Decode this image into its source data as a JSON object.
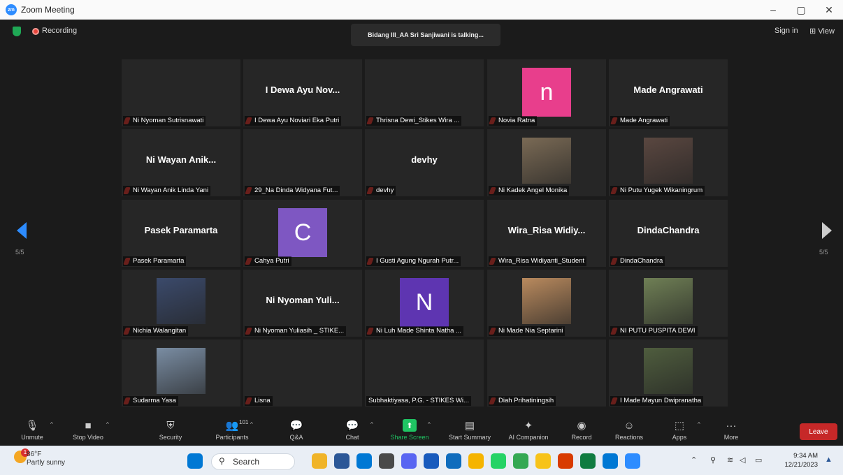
{
  "window": {
    "title": "Zoom Meeting",
    "controls": [
      "–",
      "▢",
      "✕"
    ]
  },
  "topbar": {
    "recording": "Recording",
    "talking": "Bidang III_AA Sri Sanjiwani is talking...",
    "sign_in": "Sign in",
    "view": "View"
  },
  "pagination": {
    "left": "5/5",
    "right": "5/5"
  },
  "participants": [
    {
      "name": "Ni Nyoman Sutrisnawati",
      "big": "",
      "avatar": "",
      "photo": false,
      "muted": true
    },
    {
      "name": "I Dewa Ayu Noviari Eka Putri",
      "big": "I Dewa Ayu Nov...",
      "avatar": "",
      "photo": false,
      "muted": true
    },
    {
      "name": "Thrisna Dewi_Stikes Wira ...",
      "big": "",
      "avatar": "",
      "photo": false,
      "muted": true
    },
    {
      "name": "Novia Ratna",
      "big": "",
      "avatar": "n",
      "avatar_color": "#e83e8c",
      "photo": false,
      "muted": true
    },
    {
      "name": "Made Angrawati",
      "big": "Made Angrawati",
      "avatar": "",
      "photo": false,
      "muted": true
    },
    {
      "name": "Ni Wayan Anik Linda Yani",
      "big": "Ni Wayan Anik...",
      "avatar": "",
      "photo": false,
      "muted": true
    },
    {
      "name": "29_Na Dinda Widyana Fut...",
      "big": "",
      "avatar": "",
      "photo": false,
      "muted": true
    },
    {
      "name": "devhy",
      "big": "devhy",
      "avatar": "",
      "photo": false,
      "muted": true
    },
    {
      "name": "Ni Kadek Angel Monika",
      "big": "",
      "avatar": "",
      "photo": true,
      "photo_color": "#7a6a55",
      "muted": true
    },
    {
      "name": "Ni Putu Yugek Wikaningrum",
      "big": "",
      "avatar": "",
      "photo": true,
      "photo_color": "#5a4740",
      "muted": true
    },
    {
      "name": "Pasek Paramarta",
      "big": "Pasek Paramarta",
      "avatar": "",
      "photo": false,
      "muted": true
    },
    {
      "name": "Cahya Putri",
      "big": "",
      "avatar": "C",
      "avatar_color": "#7e57c2",
      "photo": false,
      "muted": true
    },
    {
      "name": "I Gusti Agung Ngurah Putr...",
      "big": "",
      "avatar": "",
      "photo": false,
      "muted": true
    },
    {
      "name": "Wira_Risa Widiyanti_Student",
      "big": "Wira_Risa Widiy...",
      "avatar": "",
      "photo": false,
      "muted": true
    },
    {
      "name": "DindaChandra",
      "big": "DindaChandra",
      "avatar": "",
      "photo": false,
      "muted": true
    },
    {
      "name": "Nichia Walangitan",
      "big": "",
      "avatar": "",
      "photo": true,
      "photo_color": "#3b4a6b",
      "muted": true
    },
    {
      "name": "Ni Nyoman Yuliasih _ STIKE...",
      "big": "Ni Nyoman Yuli...",
      "avatar": "",
      "photo": false,
      "muted": true
    },
    {
      "name": "Ni Luh Made Shinta Natha ...",
      "big": "",
      "avatar": "N",
      "avatar_color": "#5e35b1",
      "photo": false,
      "muted": true
    },
    {
      "name": "Ni Made Nia Septarini",
      "big": "",
      "avatar": "",
      "photo": true,
      "photo_color": "#b98a5e",
      "muted": true
    },
    {
      "name": "NI PUTU PUSPITA DEWI",
      "big": "",
      "avatar": "",
      "photo": true,
      "photo_color": "#6f7f55",
      "muted": true
    },
    {
      "name": "Sudarma Yasa",
      "big": "",
      "avatar": "",
      "photo": true,
      "photo_color": "#7a8da3",
      "muted": true
    },
    {
      "name": "Lisna",
      "big": "",
      "avatar": "",
      "photo": false,
      "muted": true
    },
    {
      "name": "Subhaktiyasa, P.G. - STIKES Wi...",
      "big": "",
      "avatar": "",
      "photo": false,
      "muted": false
    },
    {
      "name": "Diah Prihatiningsih",
      "big": "",
      "avatar": "",
      "photo": false,
      "muted": true
    },
    {
      "name": "I Made Mayun Dwipranatha",
      "big": "",
      "avatar": "",
      "photo": true,
      "photo_color": "#4f5d3e",
      "muted": true
    }
  ],
  "controls": [
    {
      "label": "Unmute",
      "icon": "🎙",
      "name": "unmute-button",
      "caret": true
    },
    {
      "label": "Stop Video",
      "icon": "■",
      "name": "stop-video-button",
      "caret": true
    },
    {
      "label": "Security",
      "icon": "⛨",
      "name": "security-button",
      "caret": false
    },
    {
      "label": "Participants",
      "icon": "👥",
      "count": "101",
      "name": "participants-button",
      "caret": true
    },
    {
      "label": "Q&A",
      "icon": "💬",
      "name": "qa-button",
      "caret": false
    },
    {
      "label": "Chat",
      "icon": "💬",
      "name": "chat-button",
      "caret": true
    },
    {
      "label": "Share Screen",
      "icon": "⬆",
      "name": "share-screen-button",
      "caret": true,
      "accent": "#1fc463"
    },
    {
      "label": "Start Summary",
      "icon": "▤",
      "name": "start-summary-button",
      "caret": false
    },
    {
      "label": "AI Companion",
      "icon": "✦",
      "name": "ai-companion-button",
      "caret": false
    },
    {
      "label": "Record",
      "icon": "◉",
      "name": "record-button",
      "caret": false
    },
    {
      "label": "Reactions",
      "icon": "☺",
      "name": "reactions-button",
      "caret": false
    },
    {
      "label": "Apps",
      "icon": "⬚",
      "name": "apps-button",
      "caret": true
    },
    {
      "label": "More",
      "icon": "···",
      "name": "more-button",
      "caret": false
    }
  ],
  "leave": "Leave",
  "taskbar": {
    "weather_temp": "86°F",
    "weather_desc": "Partly sunny",
    "weather_badge": "1",
    "search": "Search",
    "time": "9:34 AM",
    "date": "12/21/2023",
    "apps": [
      "#f0b429",
      "#2b5797",
      "#0078d4",
      "#4a4a4a",
      "#5865f2",
      "#185abd",
      "#0f6cbd",
      "#f5b400",
      "#25d366",
      "#34a853",
      "#f7c31a",
      "#d83b01",
      "#107c41",
      "#0078d4",
      "#2d8cff"
    ]
  }
}
